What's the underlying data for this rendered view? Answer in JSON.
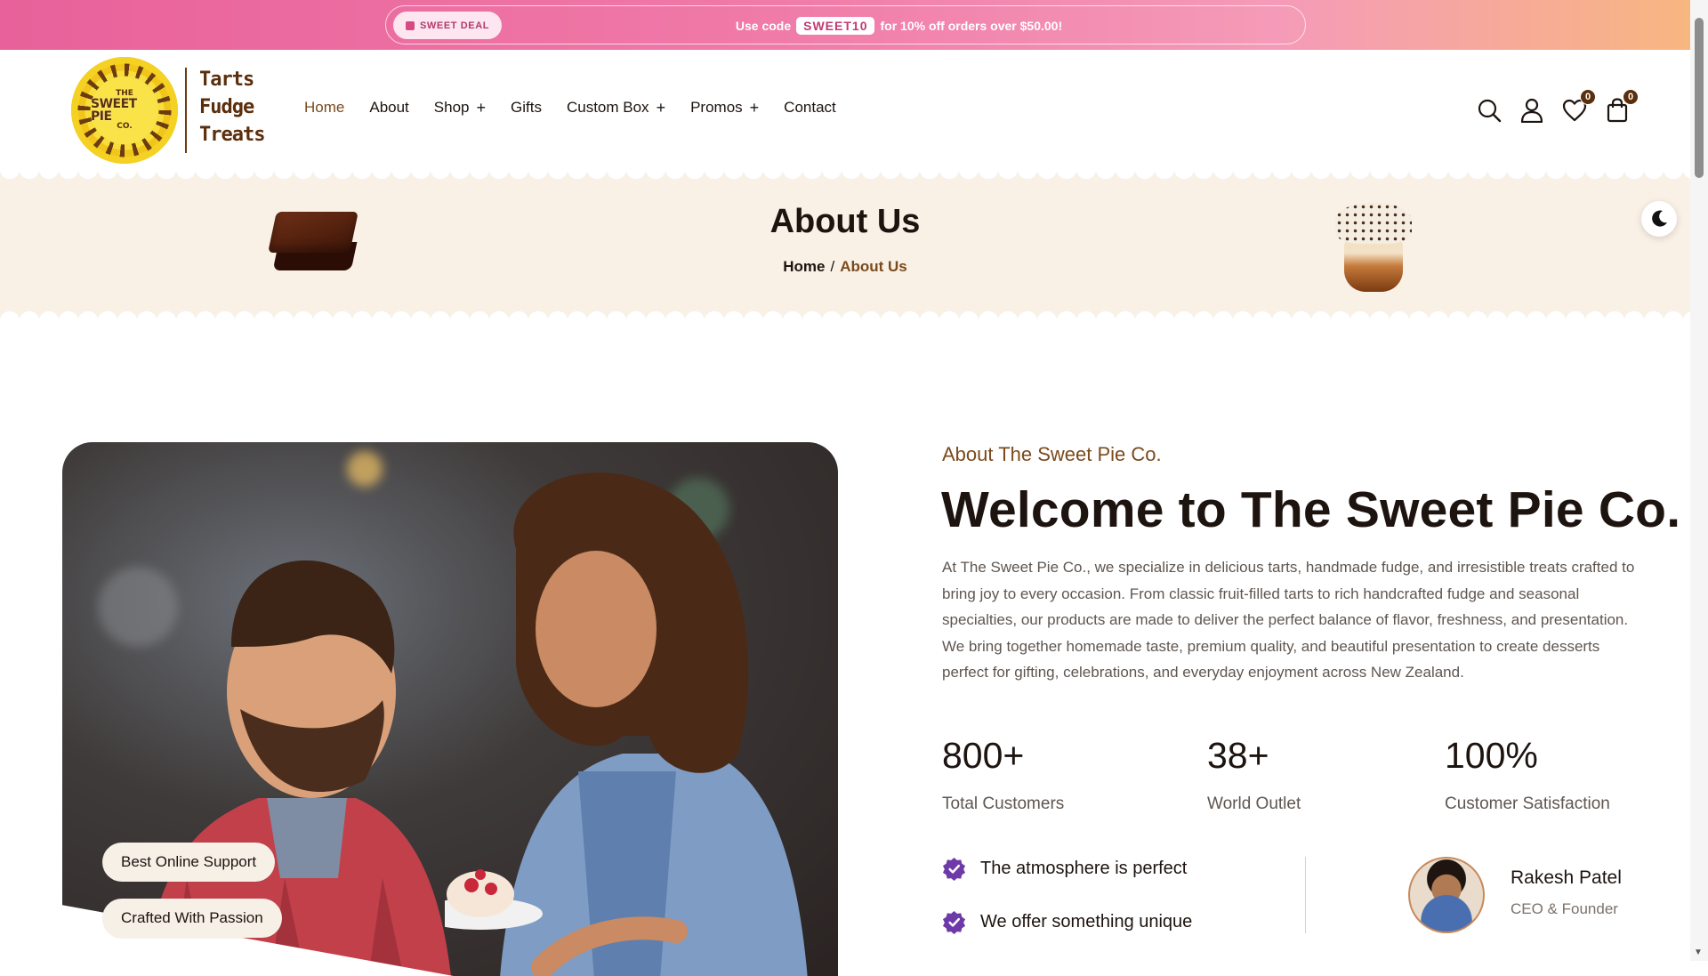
{
  "promo": {
    "tag": "SWEET DEAL",
    "prefix": "Use code",
    "code": "SWEET10",
    "suffix": "for 10% off orders over $50.00!"
  },
  "logo": {
    "badge_top": "THE",
    "badge_mid": "SWEET PIE",
    "badge_bottom": "CO.",
    "words": [
      "Tarts",
      "Fudge",
      "Treats"
    ],
    "colors": {
      "ring": "#f1c51a",
      "ink": "#5b2e0c"
    }
  },
  "nav": {
    "items": [
      {
        "label": "Home",
        "active": true,
        "has_submenu": false
      },
      {
        "label": "About",
        "active": false,
        "has_submenu": false
      },
      {
        "label": "Shop",
        "active": false,
        "has_submenu": true
      },
      {
        "label": "Gifts",
        "active": false,
        "has_submenu": false
      },
      {
        "label": "Custom Box",
        "active": false,
        "has_submenu": true
      },
      {
        "label": "Promos",
        "active": false,
        "has_submenu": true
      },
      {
        "label": "Contact",
        "active": false,
        "has_submenu": false
      }
    ],
    "submenu_glyph": "+"
  },
  "header_icons": {
    "search": "search-icon",
    "account": "user-icon",
    "wishlist": "heart-icon",
    "wishlist_count": "0",
    "cart": "shopping-bag-icon",
    "cart_count": "0"
  },
  "banner": {
    "title": "About Us",
    "crumb_home": "Home",
    "crumb_sep": "/",
    "crumb_current": "About Us",
    "theme_toggle": "moon-icon"
  },
  "about": {
    "kicker": "About The Sweet Pie Co.",
    "title": "Welcome to The Sweet Pie Co.",
    "paragraph_1": "At The Sweet Pie Co., we specialize in delicious tarts, handmade fudge, and irresistible treats crafted to bring joy to every occasion. From classic fruit-filled tarts to rich handcrafted fudge and seasonal specialties, our products are made to deliver the perfect balance of flavor, freshness, and presentation.",
    "paragraph_2": "We bring together homemade taste, premium quality, and beautiful presentation to create desserts perfect for gifting, celebrations, and everyday enjoyment across New Zealand.",
    "stats": [
      {
        "value": "800+",
        "label": "Total Customers"
      },
      {
        "value": "38+",
        "label": "World Outlet"
      },
      {
        "value": "100%",
        "label": "Customer Satisfaction"
      }
    ],
    "features": [
      "The atmosphere is perfect",
      "We offer something unique"
    ],
    "person": {
      "name": "Rakesh Patel",
      "role": "CEO & Founder"
    },
    "photo_chips": [
      "Best Online Support",
      "Crafted With Passion"
    ]
  },
  "colors": {
    "accent_brown": "#7a4a1c",
    "check_purple": "#6d3aa8",
    "banner_bg": "#f9f0e6",
    "promo_pink": "#e8619a",
    "promo_orange": "#f8b77e"
  }
}
